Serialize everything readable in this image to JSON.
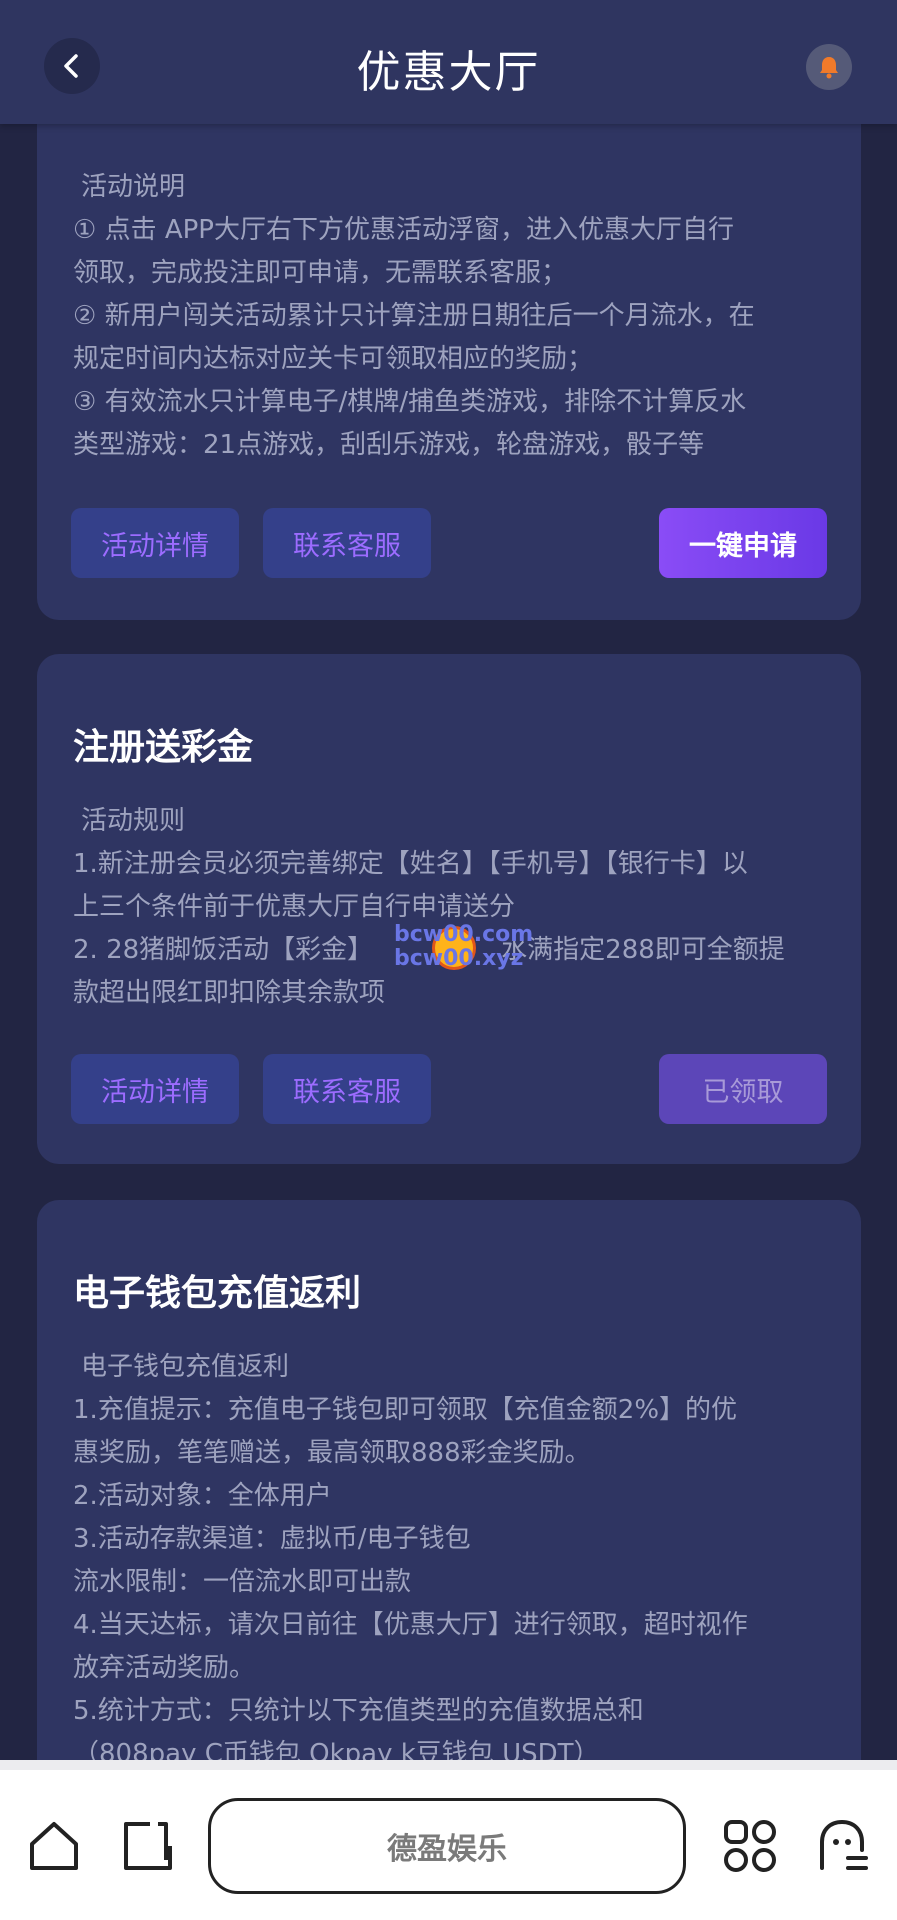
{
  "header": {
    "title": "优惠大厅"
  },
  "cards": [
    {
      "section_label": "活动说明",
      "lines": [
        "① 点击 APP大厅右下方优惠活动浮窗，进入优惠大厅自行",
        "领取，完成投注即可申请，无需联系客服；",
        "② 新用户闯关活动累计只计算注册日期往后一个月流水，在",
        "规定时间内达标对应关卡可领取相应的奖励；",
        "③ 有效流水只计算电子/棋牌/捕鱼类游戏，排除不计算反水",
        "类型游戏：21点游戏，刮刮乐游戏，轮盘游戏，骰子等"
      ],
      "buttons": {
        "detail": "活动详情",
        "service": "联系客服",
        "action": "一键申请"
      }
    },
    {
      "title": "注册送彩金",
      "section_label": "活动规则",
      "lines": [
        "1.新注册会员必须完善绑定【姓名】【手机号】【银行卡】以",
        "上三个条件前于优惠大厅自行申请送分",
        "2. 28猪脚饭活动【彩金】",
        "款超出限红即扣除其余款项"
      ],
      "line3_tail": "水满指定288即可全额提",
      "buttons": {
        "detail": "活动详情",
        "service": "联系客服",
        "action": "已领取"
      }
    },
    {
      "title": "电子钱包充值返利",
      "section_label": "电子钱包充值返利",
      "lines": [
        "1.充值提示：充值电子钱包即可领取【充值金额2%】的优",
        "惠奖励，笔笔赠送，最高领取888彩金奖励。",
        "2.活动对象：全体用户",
        "3.活动存款渠道：虚拟币/电子钱包",
        "流水限制：一倍流水即可出款",
        "4.当天达标，请次日前往【优惠大厅】进行领取，超时视作",
        "放弃活动奖励。",
        "5.统计方式：只统计以下充值类型的充值数据总和",
        "（808pay C币钱包 Okpay k豆钱包 USDT）"
      ]
    }
  ],
  "watermark": {
    "line1": "bcw00.com",
    "line2": "bcw00.xyz"
  },
  "bottom_bar": {
    "address": "德盈娱乐"
  },
  "colors": {
    "background": "#222543",
    "card": "#2f3562",
    "accent": "#8a4cf6"
  }
}
